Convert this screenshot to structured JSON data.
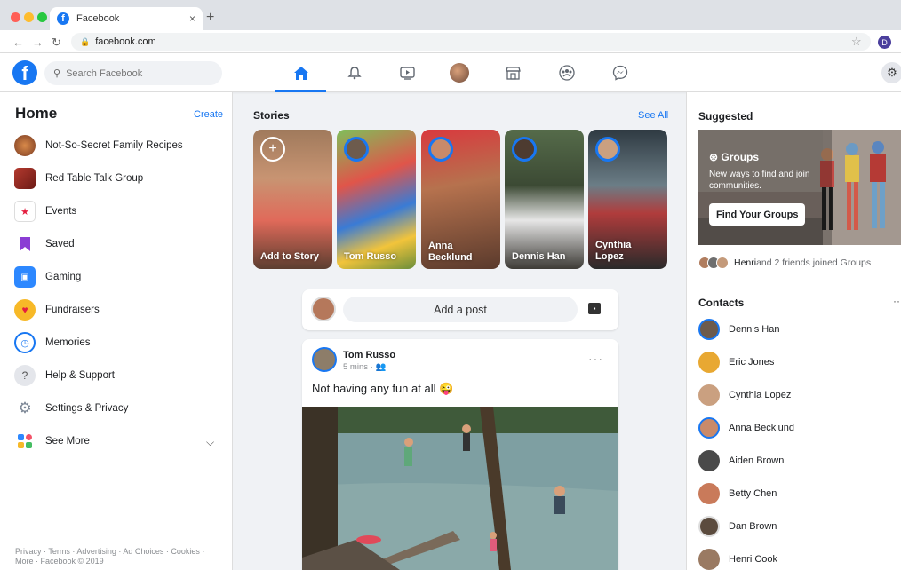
{
  "browser": {
    "tab_title": "Facebook",
    "tab_close": "×",
    "new_tab": "+",
    "url": "facebook.com",
    "profile_initial": "D"
  },
  "header": {
    "logo": "f",
    "search_placeholder": "Search Facebook",
    "nav_icons": [
      "home-icon",
      "bell-icon",
      "watch-icon",
      "profile-avatar",
      "marketplace-icon",
      "groups-icon",
      "messenger-icon"
    ]
  },
  "left": {
    "title": "Home",
    "create": "Create",
    "items": [
      {
        "label": "Not-So-Secret Family Recipes",
        "icon": "group-photo-icon"
      },
      {
        "label": "Red Table Talk Group",
        "icon": "group-photo-icon"
      },
      {
        "label": "Events",
        "icon": "calendar-icon"
      },
      {
        "label": "Saved",
        "icon": "bookmark-icon"
      },
      {
        "label": "Gaming",
        "icon": "gaming-icon"
      },
      {
        "label": "Fundraisers",
        "icon": "heart-icon"
      },
      {
        "label": "Memories",
        "icon": "clock-icon"
      },
      {
        "label": "Help & Support",
        "icon": "question-icon"
      },
      {
        "label": "Settings & Privacy",
        "icon": "gear-icon"
      },
      {
        "label": "See More",
        "icon": "see-more-icon"
      }
    ],
    "footer": "Privacy · Terms · Advertising · Ad Choices · Cookies · More · Facebook © 2019"
  },
  "stories": {
    "title": "Stories",
    "see_all": "See All",
    "items": [
      {
        "label": "Add to Story"
      },
      {
        "label": "Tom Russo"
      },
      {
        "label": "Anna Becklund"
      },
      {
        "label": "Dennis Han"
      },
      {
        "label": "Cynthia Lopez"
      }
    ]
  },
  "composer": {
    "placeholder": "Add a post"
  },
  "post": {
    "author": "Tom Russo",
    "meta": "5 mins · ",
    "text": "Not having any fun at all 😜",
    "menu": "···"
  },
  "right": {
    "suggested_title": "Suggested",
    "groups_title": "Groups",
    "groups_desc": "New ways to find and join communities.",
    "groups_button": "Find Your Groups",
    "joined_name": "Henri",
    "joined_text": " and 2 friends joined Groups",
    "contacts_title": "Contacts",
    "contacts_menu": "··",
    "contacts": [
      {
        "name": "Dennis Han"
      },
      {
        "name": "Eric Jones"
      },
      {
        "name": "Cynthia Lopez"
      },
      {
        "name": "Anna Becklund"
      },
      {
        "name": "Aiden Brown"
      },
      {
        "name": "Betty Chen"
      },
      {
        "name": "Dan Brown"
      },
      {
        "name": "Henri Cook"
      }
    ]
  },
  "colors": {
    "brand": "#1877f2",
    "background": "#f0f2f5"
  }
}
